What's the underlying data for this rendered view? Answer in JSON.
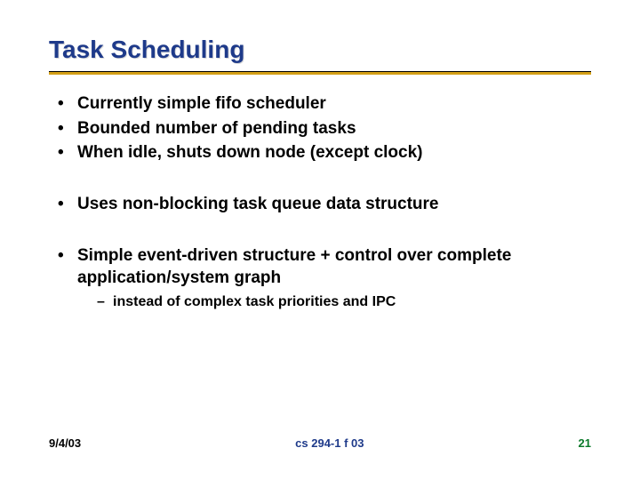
{
  "title": "Task Scheduling",
  "bullets": {
    "b1": "Currently simple fifo scheduler",
    "b2": "Bounded number of pending tasks",
    "b3": "When idle, shuts down node (except clock)",
    "b4": "Uses non-blocking task queue data structure",
    "b5": "Simple event-driven structure + control over complete application/system graph",
    "sub1": "instead of complex task priorities and IPC"
  },
  "footer": {
    "date": "9/4/03",
    "course": "cs 294-1 f 03",
    "page": "21"
  }
}
